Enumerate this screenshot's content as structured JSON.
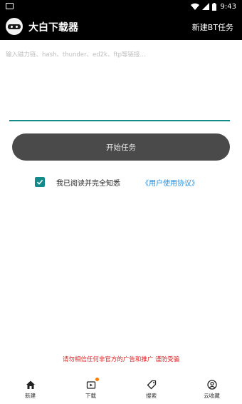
{
  "status_bar": {
    "time": "9:43"
  },
  "app_bar": {
    "title": "大白下载器",
    "new_bt_task": "新建BT任务"
  },
  "link_input": {
    "placeholder": "输入磁力链、hash、thunder、ed2k、ftp等链接...",
    "value": ""
  },
  "start_button": {
    "label": "开始任务"
  },
  "agreement": {
    "checked": true,
    "text": "我已阅读并完全知悉",
    "link": "《用户使用协议》"
  },
  "warning": "请勿相信任何非官方的广告和推广 谨防受骗",
  "bottom_nav": [
    {
      "label": "新建",
      "icon": "home-icon"
    },
    {
      "label": "下载",
      "icon": "download-icon"
    },
    {
      "label": "搜索",
      "icon": "tag-icon"
    },
    {
      "label": "云收藏",
      "icon": "user-icon"
    }
  ],
  "colors": {
    "accent": "#138b8b",
    "link": "#1e8fe0",
    "warning": "#e02424",
    "button": "#4a4a4a",
    "badge": "#ff7a00"
  }
}
